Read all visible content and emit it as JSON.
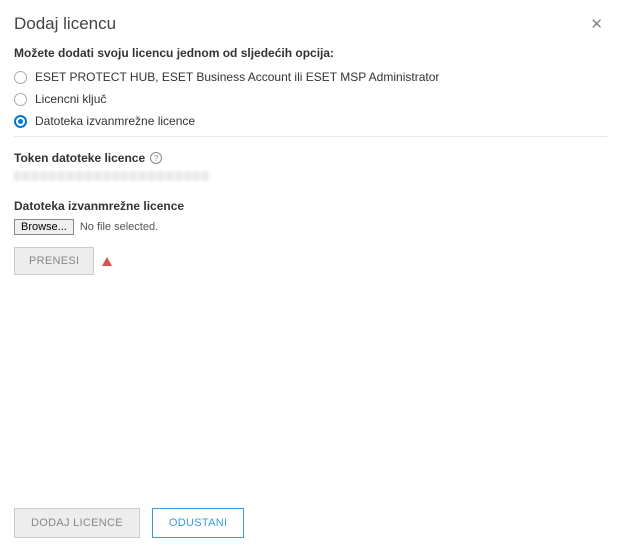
{
  "dialog": {
    "title": "Dodaj licencu"
  },
  "intro": "Možete dodati svoju licencu jednom od sljedećih opcija:",
  "options": {
    "hub": "ESET PROTECT HUB, ESET Business Account ili ESET MSP Administrator",
    "key": "Licencni ključ",
    "offline": "Datoteka izvanmrežne licence"
  },
  "token": {
    "label": "Token datoteke licence"
  },
  "offline_file": {
    "label": "Datoteka izvanmrežne licence",
    "browse": "Browse...",
    "no_file": "No file selected.",
    "upload": "PRENESI"
  },
  "footer": {
    "add": "DODAJ LICENCE",
    "cancel": "ODUSTANI"
  }
}
